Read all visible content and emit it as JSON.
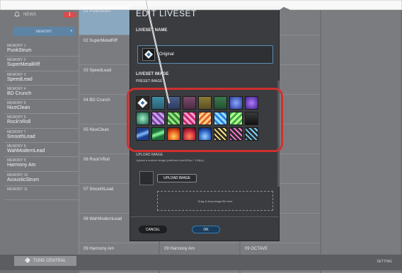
{
  "sidebar": {
    "news_label": "NEWS",
    "news_badge": "1",
    "memory_select": "MEMORY",
    "memories": [
      {
        "num": "MEMORY 1",
        "name": "PunkStrum"
      },
      {
        "num": "MEMORY 2",
        "name": "SuperMetalRiff"
      },
      {
        "num": "MEMORY 3",
        "name": "SpeedLead"
      },
      {
        "num": "MEMORY 4",
        "name": "BD Crunch"
      },
      {
        "num": "MEMORY 5",
        "name": "NiceClean"
      },
      {
        "num": "MEMORY 6",
        "name": "Rock'nRoll"
      },
      {
        "num": "MEMORY 7",
        "name": "SmoothLead"
      },
      {
        "num": "MEMORY 8",
        "name": "WahModernLead"
      },
      {
        "num": "MEMORY 9",
        "name": "Harmony Am"
      },
      {
        "num": "MEMORY 10",
        "name": "AcousticStrum"
      },
      {
        "num": "MEMORY 11",
        "name": ""
      }
    ],
    "tone_central": "TONE CENTRAL"
  },
  "grid": {
    "col1": [
      "01 PunkStrum",
      "02 SuperMetalRiff",
      "03 SpeedLead",
      "04 BD Crunch",
      "05 NiceClean",
      "06 Rock'nRoll",
      "07 SmoothLead",
      "08 WahModernLead",
      "09 Harmony Am"
    ],
    "col2_bottom": "09 Harmony Am",
    "col3": [
      "TE MY SOUL",
      "WORLD 1",
      "WORLD 2",
      "VIN",
      "VIOLIN",
      "NIZER",
      "AH",
      "",
      "09 OCTAVE"
    ],
    "setting_label": "SETTING"
  },
  "dialog": {
    "title": "EDIT LIVESET",
    "name_label": "LIVESET NAME",
    "name_value": "Original",
    "image_label": "LIVESET IMAGE",
    "preset_label": "PRESET IMAGE",
    "upload_label": "UPLOAD IMAGE",
    "upload_hint": "Upload a custom image (preferred size100px * 100px)",
    "upload_button": "UPLOAD IMAGE",
    "drop_hint": "Drag & drop image file here",
    "cancel": "CANCEL",
    "ok": "OK"
  },
  "colors": {
    "accent_red": "#d0302e",
    "accent_blue": "#3a7db0",
    "badge": "#d94c4c"
  },
  "icons": [
    "bell-icon",
    "chevron-down-icon",
    "liveset-logo-icon",
    "tone-central-icon"
  ]
}
